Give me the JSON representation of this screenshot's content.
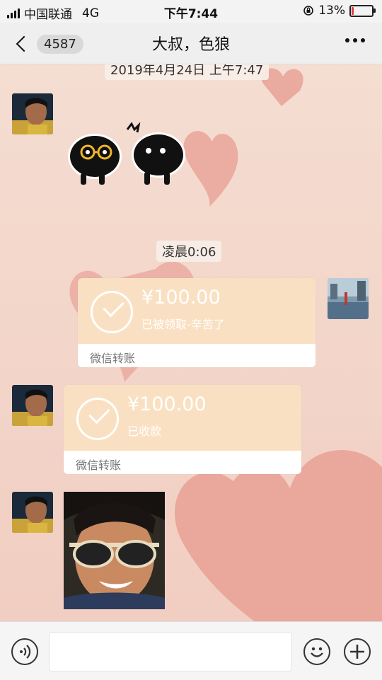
{
  "status_bar": {
    "carrier": "中国联通",
    "network": "4G",
    "time": "下午7:44",
    "battery": "13%",
    "battery_level": 0.13
  },
  "nav": {
    "unread_count": "4587",
    "title": "大叔，色狼",
    "back_icon": "chevron-left-icon",
    "more_icon": "more-dots-icon"
  },
  "chat": {
    "timestamp_top": "2019年4月24日 上午7:47",
    "timestamp_mid": "凌晨0:06",
    "messages": [
      {
        "type": "sticker",
        "from": "other"
      },
      {
        "type": "transfer",
        "from": "self",
        "amount": "¥100.00",
        "status": "已被领取-辛苦了",
        "label": "微信转账"
      },
      {
        "type": "transfer",
        "from": "other",
        "amount": "¥100.00",
        "status": "已收款",
        "label": "微信转账"
      },
      {
        "type": "photo",
        "from": "other"
      }
    ]
  },
  "input_bar": {
    "voice_icon": "voice-icon",
    "emoji_icon": "emoji-icon",
    "plus_icon": "plus-icon"
  },
  "colors": {
    "background": "#f4d9cd",
    "heart": "#e79a8f",
    "transfer_card": "#fae0c2",
    "battery_low": "#e23b3b"
  }
}
